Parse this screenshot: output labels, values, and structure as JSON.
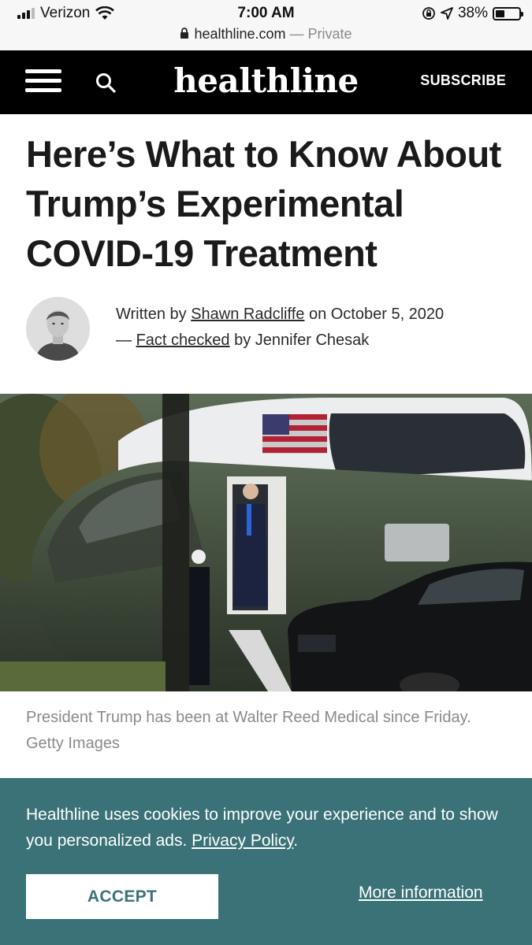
{
  "status_bar": {
    "carrier": "Verizon",
    "time": "7:00 AM",
    "battery": "38%",
    "battery_level": 0.38
  },
  "url_bar": {
    "domain": "healthline.com",
    "separator": " — ",
    "privacy": "Private"
  },
  "header": {
    "logo": "healthline",
    "subscribe": "SUBSCRIBE",
    "menu_icon": "hamburger-menu-icon",
    "search_icon": "search-icon"
  },
  "article": {
    "title": "Here’s What to Know About Trump’s Experimental COVID-19 Treatment",
    "byline": {
      "written_by": "Written by ",
      "author": "Shawn Radcliffe",
      "date_prefix": " on ",
      "date": "October 5, 2020",
      "dash": "— ",
      "fact_checked": "Fact checked",
      "by": " by ",
      "checker": "Jennifer Chesak"
    },
    "caption": "President Trump has been at Walter Reed Medical since Friday. Getty Images"
  },
  "cookie_banner": {
    "text": "Healthline uses cookies to improve your experience and to show you personalized ads. ",
    "policy_link": "Privacy Policy",
    "period": ".",
    "accept": "ACCEPT",
    "more": "More information"
  },
  "colors": {
    "header_bg": "#000000",
    "banner_bg": "#3a7278",
    "text": "#1a1a1a",
    "caption": "#8a8a8a"
  }
}
